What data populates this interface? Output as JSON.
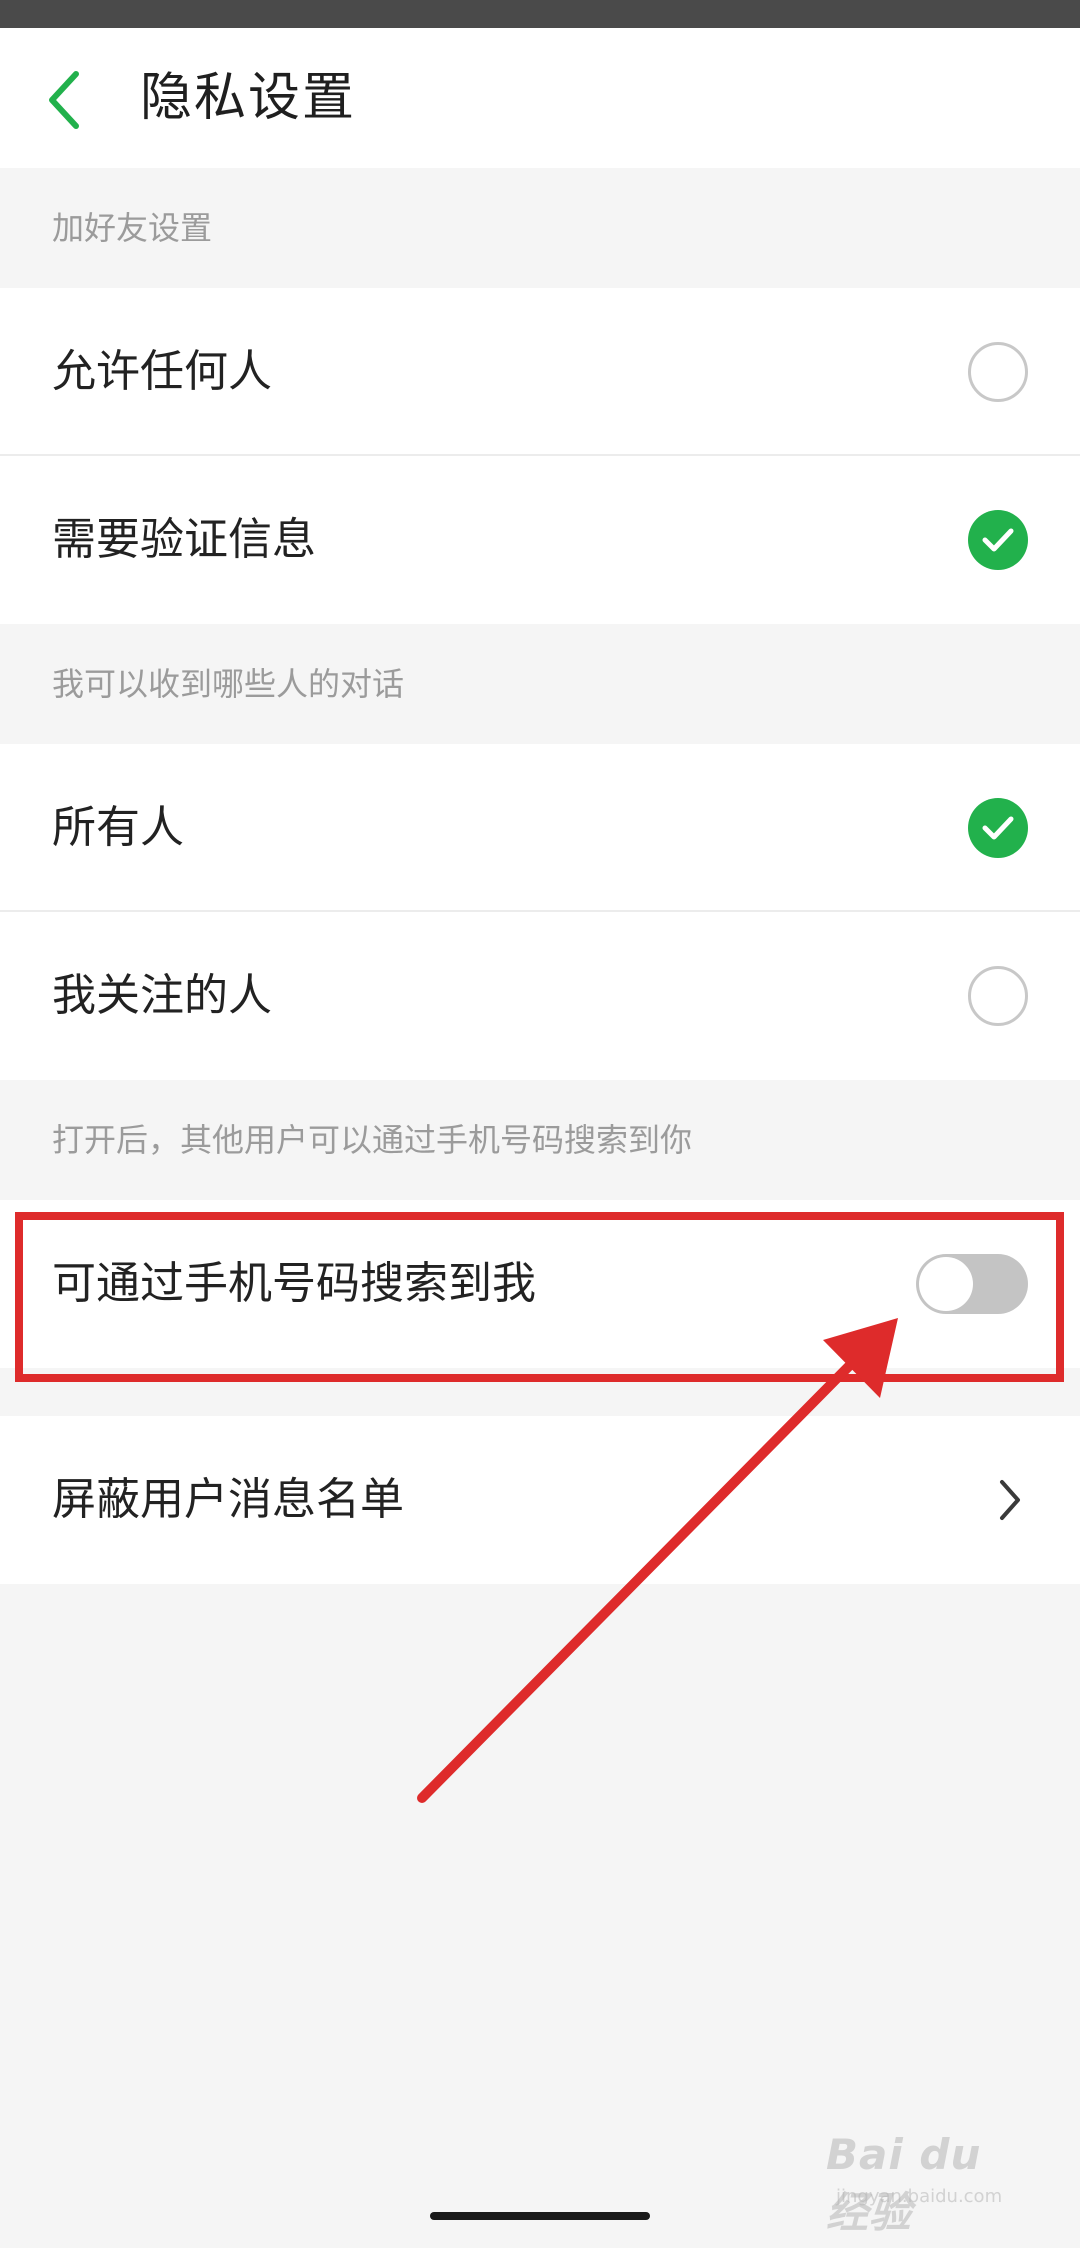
{
  "header": {
    "title": "隐私设置",
    "back_icon": "chevron-left-icon"
  },
  "sections": [
    {
      "header": "加好友设置",
      "items": [
        {
          "label": "允许任何人",
          "control": "radio",
          "checked": false
        },
        {
          "label": "需要验证信息",
          "control": "radio",
          "checked": true
        }
      ]
    },
    {
      "header": "我可以收到哪些人的对话",
      "items": [
        {
          "label": "所有人",
          "control": "radio",
          "checked": true
        },
        {
          "label": "我关注的人",
          "control": "radio",
          "checked": false
        }
      ]
    },
    {
      "header": "打开后，其他用户可以通过手机号码搜索到你",
      "items": [
        {
          "label": "可通过手机号码搜索到我",
          "control": "toggle",
          "on": false
        }
      ]
    },
    {
      "header": "",
      "items": [
        {
          "label": "屏蔽用户消息名单",
          "control": "chevron-right-icon"
        }
      ]
    }
  ],
  "colors": {
    "accent_green": "#22b14c",
    "annotation_red": "#de2b2b",
    "background": "#f5f5f5"
  },
  "watermark": {
    "logo": "Bai du 经验",
    "url": "jingyan.baidu.com"
  }
}
